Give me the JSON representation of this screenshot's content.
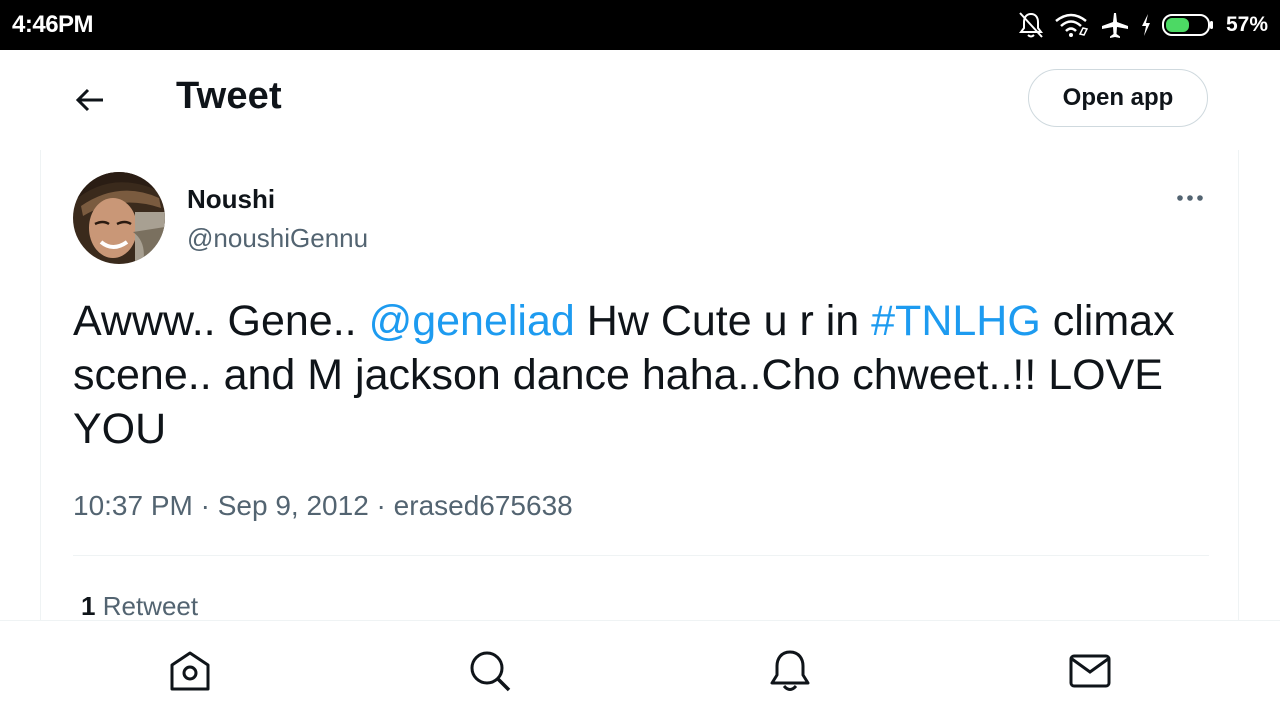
{
  "status_bar": {
    "time": "4:46PM",
    "battery_percent": "57%",
    "battery_level": 0.57,
    "icons": [
      "notifications-off-icon",
      "wifi-icon",
      "airplane-icon",
      "charging-icon",
      "battery-icon"
    ]
  },
  "header": {
    "title": "Tweet",
    "open_app_label": "Open app"
  },
  "tweet": {
    "author": {
      "display_name": "Noushi",
      "handle": "@noushiGennu"
    },
    "text": {
      "part1": "Awww.. Gene.. ",
      "mention": "@geneliad",
      "part2": " Hw Cute u r in ",
      "hashtag": "#TNLHG",
      "part3": " climax scene.. and M jackson dance haha..Cho chweet..!! LOVE YOU"
    },
    "meta": {
      "time": "10:37 PM",
      "separator": " · ",
      "date": "Sep 9, 2012",
      "source": "erased675638"
    },
    "stats": {
      "retweet_count": "1",
      "retweet_label": "Retweet"
    }
  },
  "bottom_nav": {
    "items": [
      "home-icon",
      "search-icon",
      "notifications-icon",
      "messages-icon"
    ]
  },
  "colors": {
    "link": "#1d9bf0",
    "secondary_text": "#536471",
    "primary_text": "#0f1419",
    "border": "#cfd9de",
    "battery_fill": "#4cd964"
  }
}
